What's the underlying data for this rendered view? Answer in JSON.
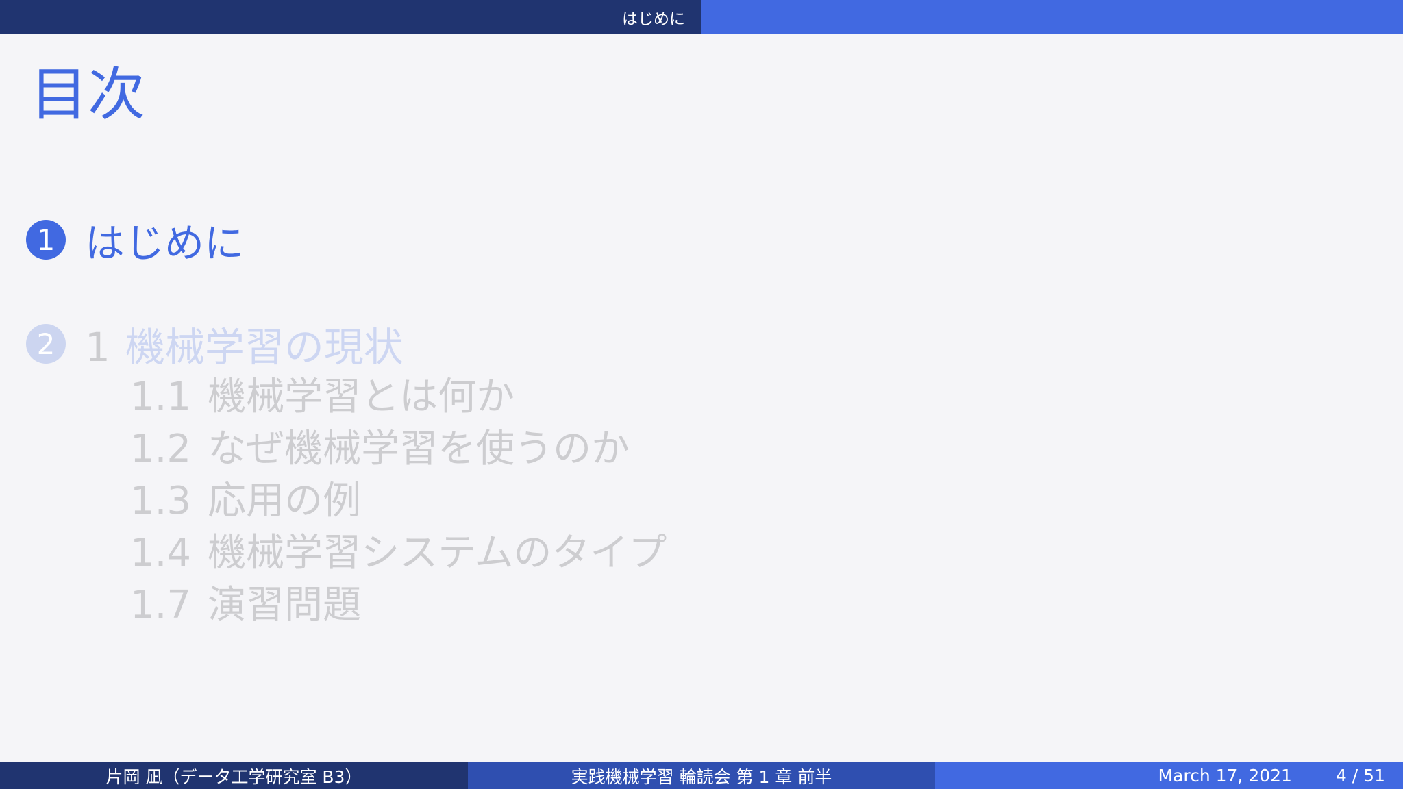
{
  "header": {
    "section": "はじめに"
  },
  "slide": {
    "title": "目次"
  },
  "toc": {
    "sections": [
      {
        "num": "1",
        "label": "はじめに"
      },
      {
        "num": "2",
        "prefix": "1",
        "label": "機械学習の現状"
      }
    ],
    "subsections": [
      {
        "num": "1.1",
        "label": "機械学習とは何か"
      },
      {
        "num": "1.2",
        "label": "なぜ機械学習を使うのか"
      },
      {
        "num": "1.3",
        "label": "応用の例"
      },
      {
        "num": "1.4",
        "label": "機械学習システムのタイプ"
      },
      {
        "num": "1.7",
        "label": "演習問題"
      }
    ]
  },
  "footer": {
    "author": "片岡 凪（データ工学研究室 B3）",
    "talk": "実践機械学習 輪読会 第 1 章 前半",
    "date": "March 17, 2021",
    "page": "4 / 51"
  },
  "colors": {
    "accent": "#4169e1",
    "dark": "#203470"
  }
}
